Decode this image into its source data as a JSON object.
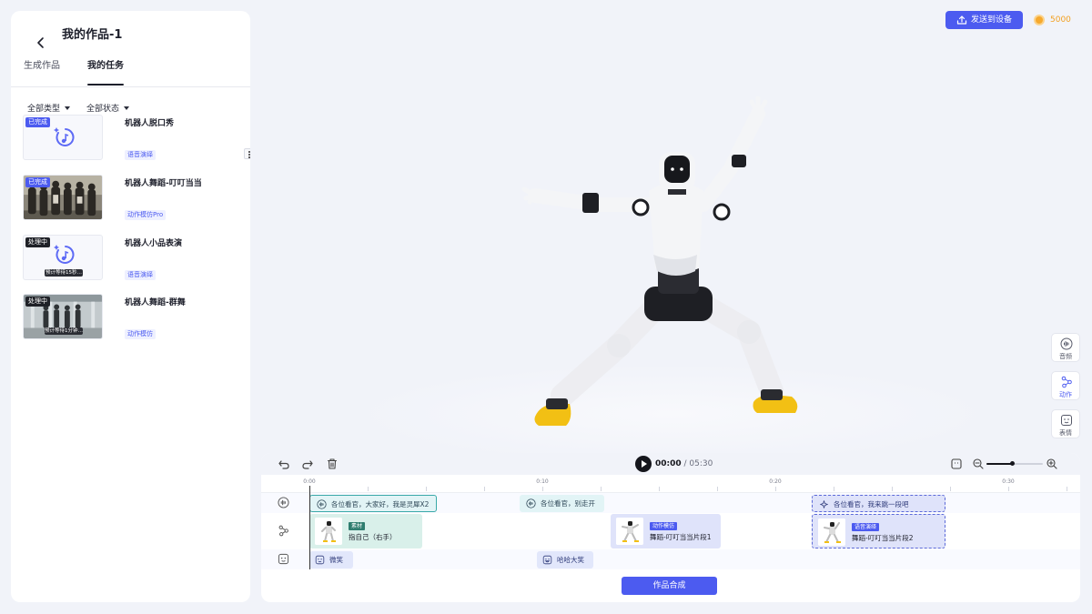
{
  "left_panel": {
    "title": "我的作品-1",
    "tabs": [
      {
        "label": "生成作品"
      },
      {
        "label": "我的任务"
      }
    ],
    "filters": [
      {
        "label": "全部类型"
      },
      {
        "label": "全部状态"
      }
    ],
    "tasks": [
      {
        "title": "机器人脱口秀",
        "status": "已完成",
        "tag": "语音演绎"
      },
      {
        "title": "机器人舞蹈-叮叮当当",
        "status": "已完成",
        "tag": "动作模仿Pro"
      },
      {
        "title": "机器人小品表演",
        "status": "处理中",
        "tag": "语音演绎",
        "eta": "预计等待15秒…"
      },
      {
        "title": "机器人舞蹈-群舞",
        "status": "处理中",
        "tag": "动作模仿",
        "eta": "预计等待1分钟…"
      }
    ]
  },
  "header": {
    "send_label": "发送到设备",
    "coins": "5000"
  },
  "side_tools": [
    {
      "label": "音频"
    },
    {
      "label": "动作"
    },
    {
      "label": "表情"
    }
  ],
  "timeline": {
    "current_time": "00:00",
    "total_time": " / 05:30",
    "zoom_level": 0.45,
    "ruler_labels": [
      "0:00",
      "0:10",
      "0:20",
      "0:30"
    ],
    "audio_clips": [
      {
        "text": "各位看官，大家好，我是灵犀X2"
      },
      {
        "text": "各位看官，别走开"
      },
      {
        "text": "各位看官，我来跳一段吧"
      }
    ],
    "action_clips": [
      {
        "badge": "素材",
        "name": "指自己（右手）"
      },
      {
        "badge": "动作模仿",
        "name": "舞蹈-叮叮当当片段1"
      },
      {
        "badge": "语音演绎",
        "name": "舞蹈-叮叮当当片段2"
      }
    ],
    "expression_clips": [
      {
        "text": "微笑"
      },
      {
        "text": "哈哈大笑"
      }
    ],
    "compose_label": "作品合成"
  },
  "colors": {
    "accent": "#4c5bf0",
    "coin": "#f2a021",
    "teal_badge": "#2f7d6f"
  }
}
